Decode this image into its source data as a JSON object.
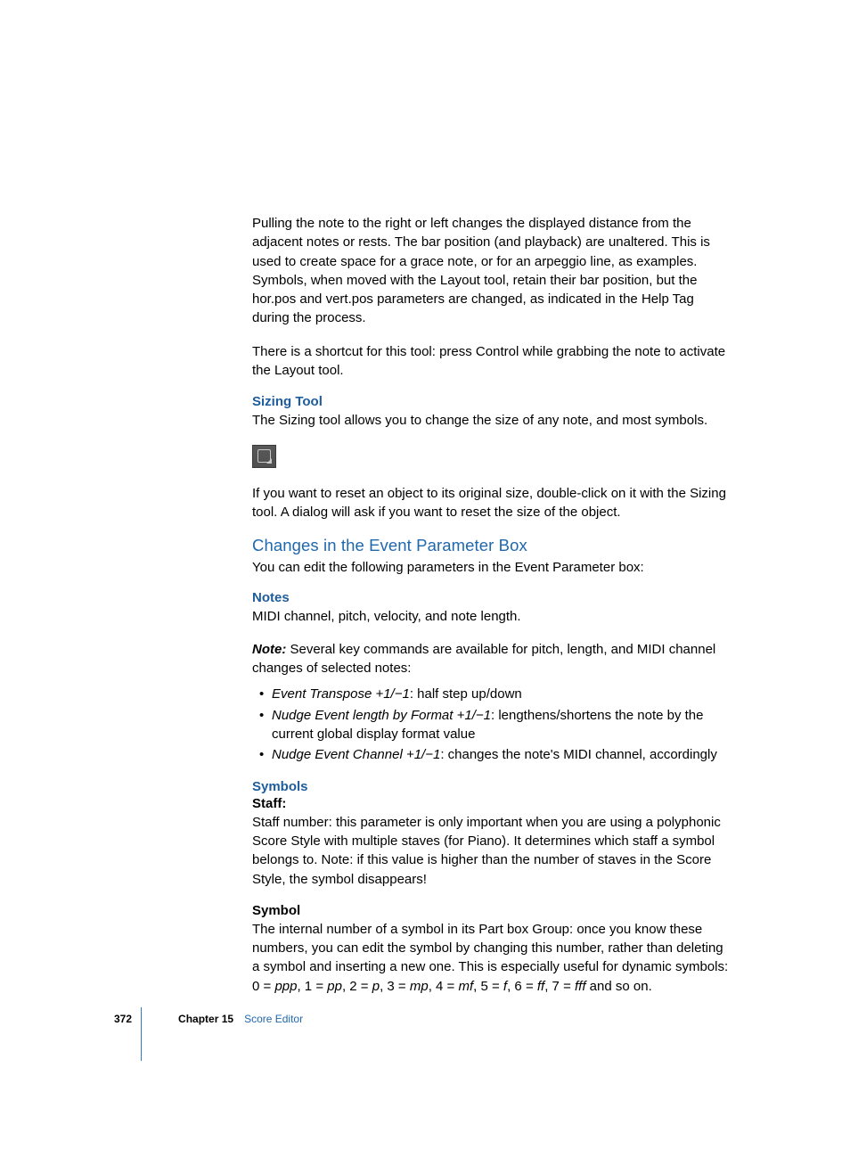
{
  "body": {
    "p1": "Pulling the note to the right or left changes the displayed distance from the adjacent notes or rests. The bar position (and playback) are unaltered. This is used to create space for a grace note, or for an arpeggio line, as examples. Symbols, when moved with the Layout tool, retain their bar position, but the hor.pos and vert.pos parameters are changed, as indicated in the Help Tag during the process.",
    "p2": "There is a shortcut for this tool:  press Control while grabbing the note to activate the Layout tool.",
    "h_sizing": "Sizing Tool",
    "p3": "The Sizing tool allows you to change the size of any note, and most symbols.",
    "p4": "If you want to reset an object to its original size, double-click on it with the Sizing tool. A dialog will ask if you want to reset the size of the object.",
    "h_changes": "Changes in the Event Parameter Box",
    "p5": "You can edit the following parameters in the Event Parameter box:",
    "h_notes": "Notes",
    "p6": "MIDI channel, pitch, velocity, and note length.",
    "note_label": "Note:",
    "note_text": "  Several key commands are available for pitch, length, and MIDI channel changes of selected notes:",
    "li1_em": "Event Transpose +1/−1",
    "li1_rest": ":  half step up/down",
    "li2_em": "Nudge Event length by Format +1/−1",
    "li2_rest": ":  lengthens/shortens the note by the current global display format value",
    "li3_em": "Nudge Event Channel +1/−1",
    "li3_rest": ":  changes the note's MIDI channel, accordingly",
    "h_symbols": "Symbols",
    "staff_label": "Staff:",
    "p7": "Staff number:  this parameter is only important when you are using a polyphonic Score Style with multiple staves (for Piano). It determines which staff a symbol belongs to. Note:  if this value is higher than the number of staves in the Score Style, the symbol disappears!",
    "symbol_label": "Symbol",
    "p8_a": "The internal number of a symbol in its Part box Group:  once you know these numbers, you can edit the symbol by changing this number, rather than deleting a symbol and inserting a new one. This is especially useful for dynamic symbols:  0 = ",
    "p8_ppp": "ppp",
    "p8_b": ", 1 = ",
    "p8_pp": "pp",
    "p8_c": ", 2 = ",
    "p8_p": "p",
    "p8_d": ", 3 = ",
    "p8_mp": "mp",
    "p8_e": ", 4 = ",
    "p8_mf": "mf",
    "p8_f": ", 5 = ",
    "p8_fv": "f",
    "p8_g": ", 6 = ",
    "p8_ff": "ff",
    "p8_h": ", 7 = ",
    "p8_fff": "fff",
    "p8_i": " and so on."
  },
  "footer": {
    "page": "372",
    "chapter_label": "Chapter 15",
    "chapter_title": "Score Editor"
  }
}
